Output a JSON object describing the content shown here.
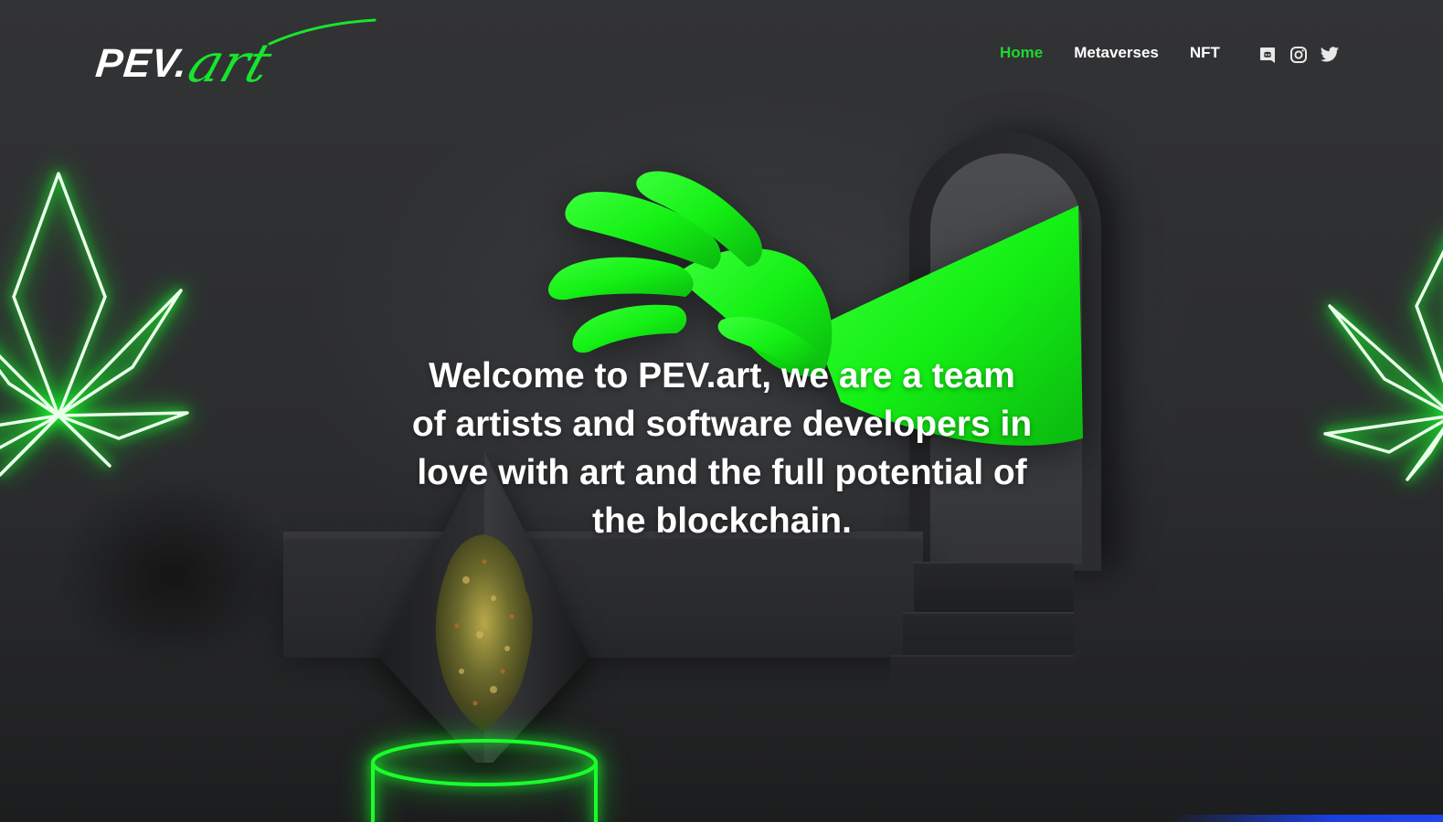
{
  "header": {
    "logo": {
      "main": "PEV.",
      "script": "art"
    },
    "nav": [
      {
        "label": "Home",
        "active": true
      },
      {
        "label": "Metaverses",
        "active": false
      },
      {
        "label": "NFT",
        "active": false
      }
    ],
    "social": [
      {
        "icon": "discord-icon"
      },
      {
        "icon": "instagram-icon"
      },
      {
        "icon": "twitter-icon"
      }
    ]
  },
  "hero": {
    "line1": "Welcome to PEV.art, we are a team",
    "line2": "of artists and software developers in",
    "line3": "love with art and the full potential of",
    "line4": "the blockchain."
  },
  "colors": {
    "accent": "#1ed82f",
    "neon": "#19ff2d",
    "background": "#2b2c2e",
    "text": "#ffffff"
  }
}
